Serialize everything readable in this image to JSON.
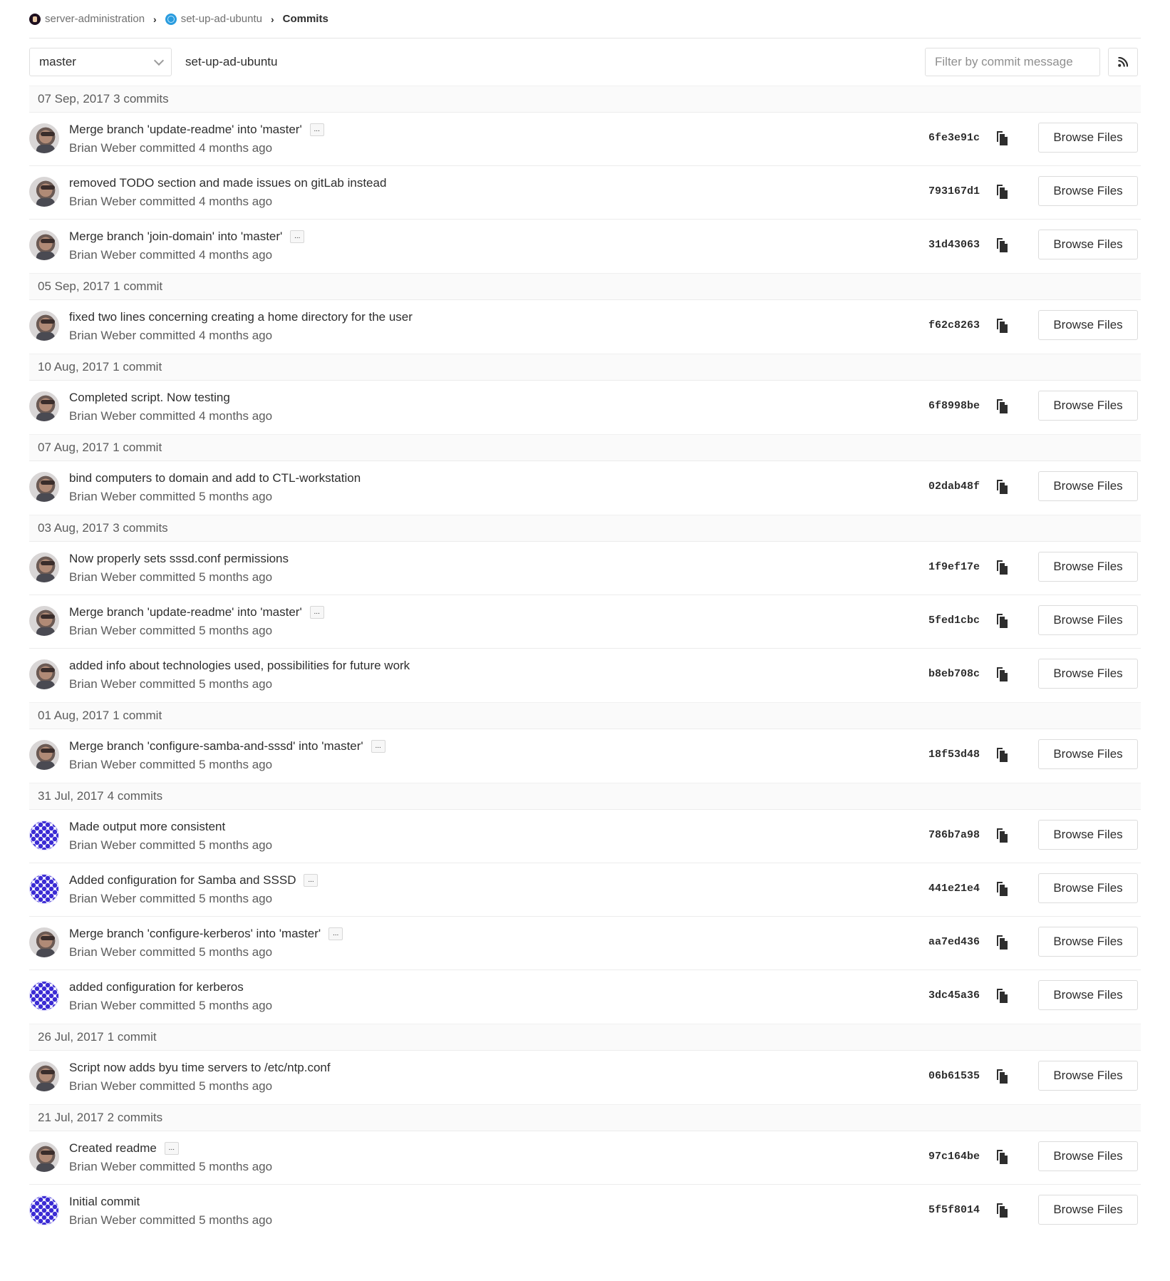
{
  "breadcrumb": {
    "group": "server-administration",
    "project": "set-up-ad-ubuntu",
    "current": "Commits"
  },
  "toolbar": {
    "branch": "master",
    "path": "set-up-ad-ubuntu",
    "filter_placeholder": "Filter by commit message",
    "rss_icon": "rss-icon"
  },
  "browse_label": "Browse Files",
  "groups": [
    {
      "date": "07 Sep, 2017",
      "count": "3 commits",
      "commits": [
        {
          "title": "Merge branch 'update-readme' into 'master'",
          "ellipsis": true,
          "author": "Brian Weber",
          "verb": "committed",
          "time": "4 months ago",
          "sha": "6fe3e91c",
          "avatar": "photo"
        },
        {
          "title": "removed TODO section and made issues on gitLab instead",
          "ellipsis": false,
          "author": "Brian Weber",
          "verb": "committed",
          "time": "4 months ago",
          "sha": "793167d1",
          "avatar": "photo"
        },
        {
          "title": "Merge branch 'join-domain' into 'master'",
          "ellipsis": true,
          "author": "Brian Weber",
          "verb": "committed",
          "time": "4 months ago",
          "sha": "31d43063",
          "avatar": "photo"
        }
      ]
    },
    {
      "date": "05 Sep, 2017",
      "count": "1 commit",
      "commits": [
        {
          "title": "fixed two lines concerning creating a home directory for the user",
          "ellipsis": false,
          "author": "Brian Weber",
          "verb": "committed",
          "time": "4 months ago",
          "sha": "f62c8263",
          "avatar": "photo"
        }
      ]
    },
    {
      "date": "10 Aug, 2017",
      "count": "1 commit",
      "commits": [
        {
          "title": "Completed script. Now testing",
          "ellipsis": false,
          "author": "Brian Weber",
          "verb": "committed",
          "time": "4 months ago",
          "sha": "6f8998be",
          "avatar": "photo"
        }
      ]
    },
    {
      "date": "07 Aug, 2017",
      "count": "1 commit",
      "commits": [
        {
          "title": "bind computers to domain and add to CTL-workstation",
          "ellipsis": false,
          "author": "Brian Weber",
          "verb": "committed",
          "time": "5 months ago",
          "sha": "02dab48f",
          "avatar": "photo"
        }
      ]
    },
    {
      "date": "03 Aug, 2017",
      "count": "3 commits",
      "commits": [
        {
          "title": "Now properly sets sssd.conf permissions",
          "ellipsis": false,
          "author": "Brian Weber",
          "verb": "committed",
          "time": "5 months ago",
          "sha": "1f9ef17e",
          "avatar": "photo"
        },
        {
          "title": "Merge branch 'update-readme' into 'master'",
          "ellipsis": true,
          "author": "Brian Weber",
          "verb": "committed",
          "time": "5 months ago",
          "sha": "5fed1cbc",
          "avatar": "photo"
        },
        {
          "title": "added info about technologies used, possibilities for future work",
          "ellipsis": false,
          "author": "Brian Weber",
          "verb": "committed",
          "time": "5 months ago",
          "sha": "b8eb708c",
          "avatar": "photo"
        }
      ]
    },
    {
      "date": "01 Aug, 2017",
      "count": "1 commit",
      "commits": [
        {
          "title": "Merge branch 'configure-samba-and-sssd' into 'master'",
          "ellipsis": true,
          "author": "Brian Weber",
          "verb": "committed",
          "time": "5 months ago",
          "sha": "18f53d48",
          "avatar": "photo"
        }
      ]
    },
    {
      "date": "31 Jul, 2017",
      "count": "4 commits",
      "commits": [
        {
          "title": "Made output more consistent",
          "ellipsis": false,
          "author": "Brian Weber",
          "verb": "committed",
          "time": "5 months ago",
          "sha": "786b7a98",
          "avatar": "identicon"
        },
        {
          "title": "Added configuration for Samba and SSSD",
          "ellipsis": true,
          "author": "Brian Weber",
          "verb": "committed",
          "time": "5 months ago",
          "sha": "441e21e4",
          "avatar": "identicon"
        },
        {
          "title": "Merge branch 'configure-kerberos' into 'master'",
          "ellipsis": true,
          "author": "Brian Weber",
          "verb": "committed",
          "time": "5 months ago",
          "sha": "aa7ed436",
          "avatar": "photo"
        },
        {
          "title": "added configuration for kerberos",
          "ellipsis": false,
          "author": "Brian Weber",
          "verb": "committed",
          "time": "5 months ago",
          "sha": "3dc45a36",
          "avatar": "identicon"
        }
      ]
    },
    {
      "date": "26 Jul, 2017",
      "count": "1 commit",
      "commits": [
        {
          "title": "Script now adds byu time servers to /etc/ntp.conf",
          "ellipsis": false,
          "author": "Brian Weber",
          "verb": "committed",
          "time": "5 months ago",
          "sha": "06b61535",
          "avatar": "photo"
        }
      ]
    },
    {
      "date": "21 Jul, 2017",
      "count": "2 commits",
      "commits": [
        {
          "title": "Created readme",
          "ellipsis": true,
          "author": "Brian Weber",
          "verb": "committed",
          "time": "5 months ago",
          "sha": "97c164be",
          "avatar": "photo"
        },
        {
          "title": "Initial commit",
          "ellipsis": false,
          "author": "Brian Weber",
          "verb": "committed",
          "time": "5 months ago",
          "sha": "5f5f8014",
          "avatar": "identicon"
        }
      ]
    }
  ]
}
